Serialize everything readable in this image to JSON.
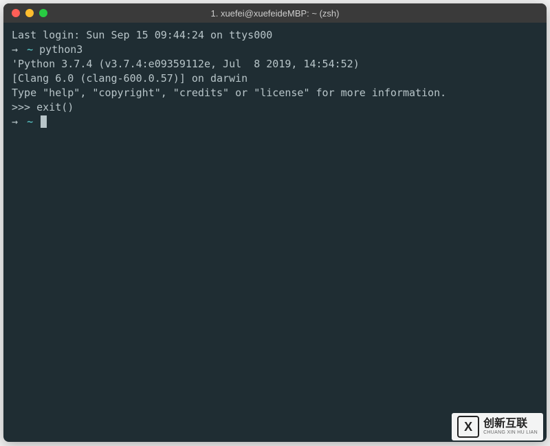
{
  "window": {
    "title": "1. xuefei@xuefeideMBP: ~ (zsh)"
  },
  "terminal": {
    "lines": {
      "last_login": "Last login: Sun Sep 15 09:44:24 on ttys000",
      "cmd1": "python3",
      "py_version": "'Python 3.7.4 (v3.7.4:e09359112e, Jul  8 2019, 14:54:52)",
      "py_clang": "[Clang 6.0 (clang-600.0.57)] on darwin",
      "py_help": "Type \"help\", \"copyright\", \"credits\" or \"license\" for more information.",
      "py_prompt": ">>> ",
      "py_exit": "exit()"
    },
    "prompt": {
      "arrow": "→",
      "tilde": "~"
    }
  },
  "watermark": {
    "logo_letter": "X",
    "cn": "创新互联",
    "en": "CHUANG XIN HU LIAN"
  }
}
